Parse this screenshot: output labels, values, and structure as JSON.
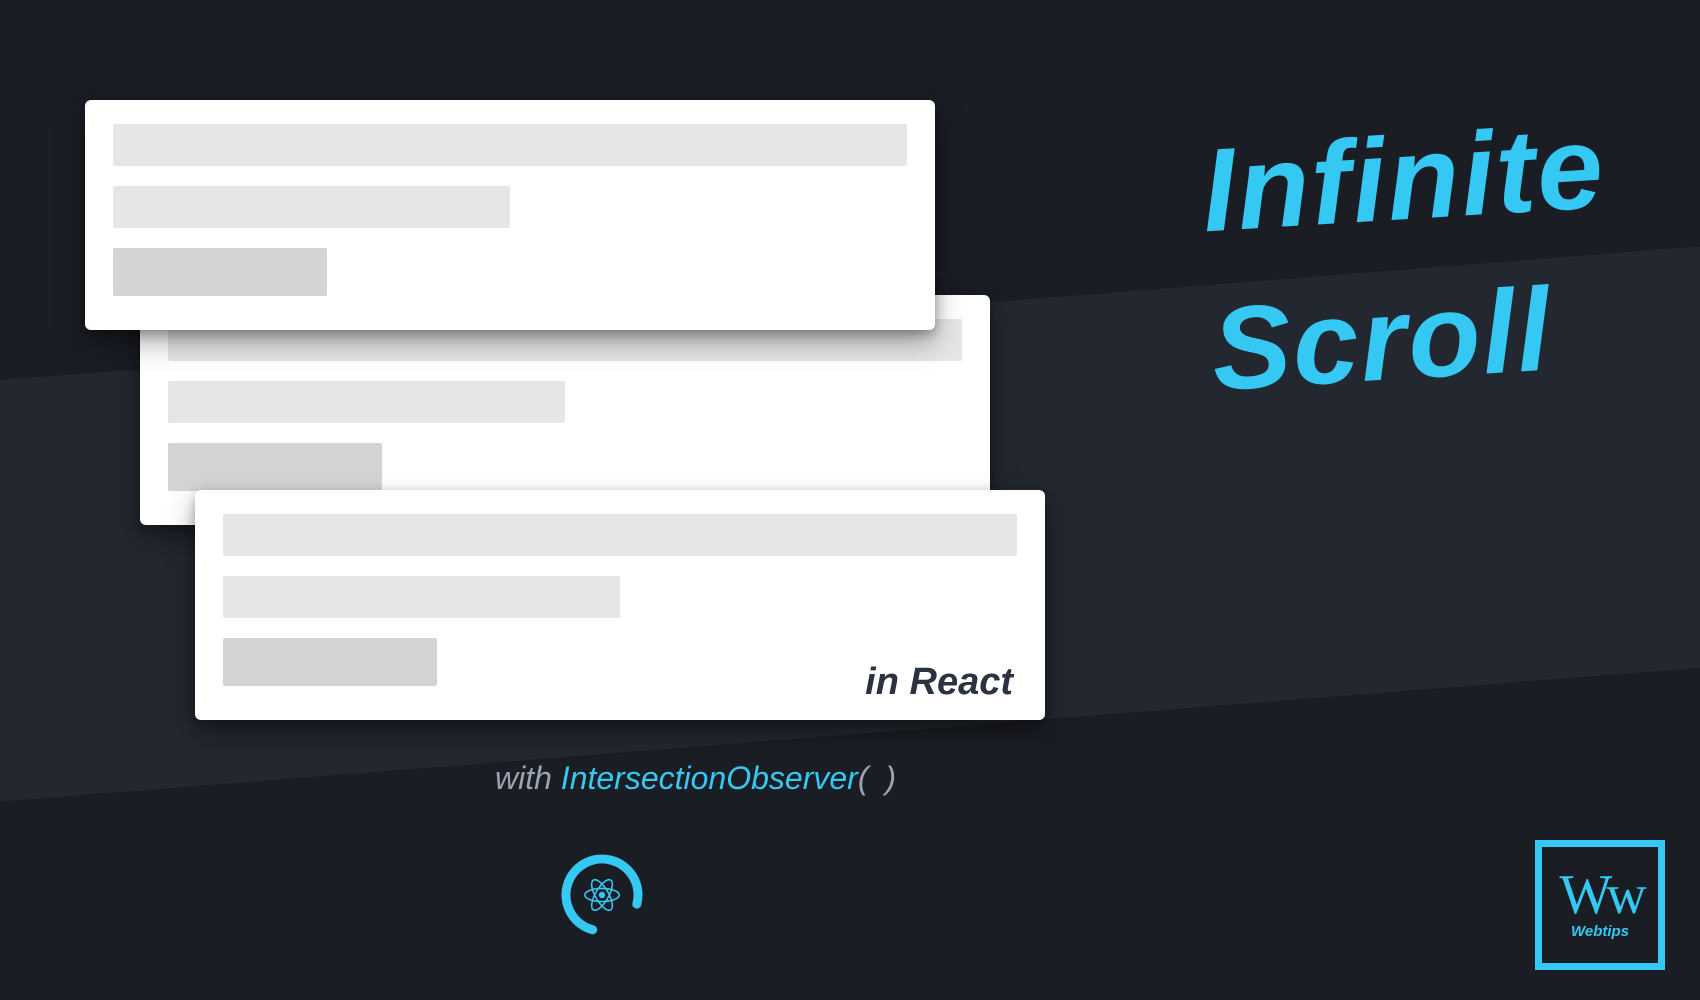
{
  "headline": {
    "line1": "Infinite",
    "line2": "Scroll"
  },
  "card3": {
    "label": "in React"
  },
  "subtitle": {
    "prefix": "with ",
    "accent": "IntersectionObserver",
    "parens": "( )"
  },
  "logo": {
    "mark": "Ww",
    "text": "Webtips"
  },
  "colors": {
    "accent": "#35c8f2",
    "bgDark": "#1a1d24",
    "bgBand": "#23272f"
  }
}
